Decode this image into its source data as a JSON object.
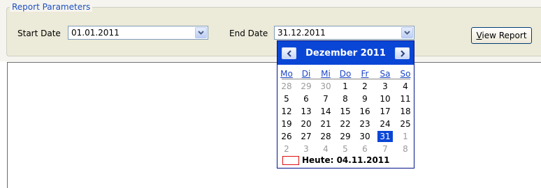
{
  "params": {
    "legend": "Report Parameters",
    "start_label": "Start Date",
    "start_value": "01.01.2011",
    "end_label": "End Date",
    "end_value": "31.12.2011",
    "view_btn_key": "V",
    "view_btn_rest": "iew Report"
  },
  "calendar": {
    "month_title": "Dezember 2011",
    "weekdays": [
      "Mo",
      "Di",
      "Mi",
      "Do",
      "Fr",
      "Sa",
      "So"
    ],
    "weeks": [
      [
        {
          "d": "28",
          "o": true
        },
        {
          "d": "29",
          "o": true
        },
        {
          "d": "30",
          "o": true
        },
        {
          "d": "1"
        },
        {
          "d": "2"
        },
        {
          "d": "3"
        },
        {
          "d": "4"
        }
      ],
      [
        {
          "d": "5"
        },
        {
          "d": "6"
        },
        {
          "d": "7"
        },
        {
          "d": "8"
        },
        {
          "d": "9"
        },
        {
          "d": "10"
        },
        {
          "d": "11"
        }
      ],
      [
        {
          "d": "12"
        },
        {
          "d": "13"
        },
        {
          "d": "14"
        },
        {
          "d": "15"
        },
        {
          "d": "16"
        },
        {
          "d": "17"
        },
        {
          "d": "18"
        }
      ],
      [
        {
          "d": "19"
        },
        {
          "d": "20"
        },
        {
          "d": "21"
        },
        {
          "d": "22"
        },
        {
          "d": "23"
        },
        {
          "d": "24"
        },
        {
          "d": "25"
        }
      ],
      [
        {
          "d": "26"
        },
        {
          "d": "27"
        },
        {
          "d": "28"
        },
        {
          "d": "29"
        },
        {
          "d": "30"
        },
        {
          "d": "31",
          "sel": true
        },
        {
          "d": "1",
          "o": true
        }
      ],
      [
        {
          "d": "2",
          "o": true
        },
        {
          "d": "3",
          "o": true
        },
        {
          "d": "4",
          "o": true
        },
        {
          "d": "5",
          "o": true
        },
        {
          "d": "6",
          "o": true
        },
        {
          "d": "7",
          "o": true
        },
        {
          "d": "8",
          "o": true
        }
      ]
    ],
    "today_label": "Heute: 04.11.2011"
  },
  "colors": {
    "accent": "#0a46d6",
    "legend_text": "#1f50c0",
    "panel_bg": "#ecead8"
  }
}
